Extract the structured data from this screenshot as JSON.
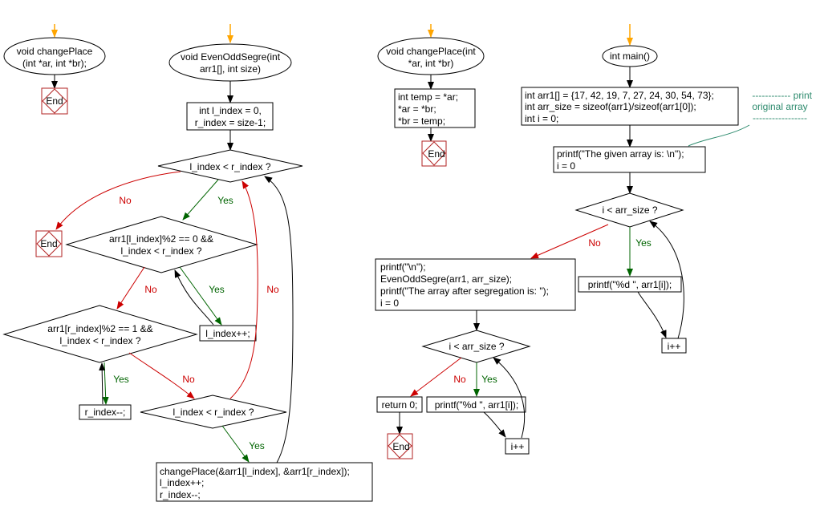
{
  "colors": {
    "yes": "#006400",
    "no": "#cc0000",
    "entry": "#ffa500",
    "end": "#b22222",
    "comment": "#2e8b6e"
  },
  "end_label": "End",
  "yes": "Yes",
  "no": "No",
  "changePlace_decl": {
    "lines": [
      "void changePlace",
      "(int *ar, int *br);"
    ]
  },
  "evenOdd": {
    "start": {
      "lines": [
        "void EvenOddSegre(int",
        "arr1[], int size)"
      ]
    },
    "init": {
      "lines": [
        "int l_index = 0,",
        "r_index = size-1;"
      ]
    },
    "cond_outer": "l_index < r_index ?",
    "cond_even": {
      "lines": [
        "arr1[l_index]%2 == 0 &&",
        "l_index < r_index ?"
      ]
    },
    "inc_l": "l_index++;",
    "cond_odd": {
      "lines": [
        "arr1[r_index]%2 == 1 &&",
        "l_index < r_index ?"
      ]
    },
    "dec_r": "r_index--;",
    "cond_swap": "l_index < r_index ?",
    "swap": {
      "lines": [
        "changePlace(&arr1[l_index], &arr1[r_index]);",
        "l_index++;",
        "r_index--;"
      ]
    }
  },
  "changePlace_def": {
    "start": {
      "lines": [
        "void changePlace(int",
        "*ar, int *br)"
      ]
    },
    "body": {
      "lines": [
        "int temp = *ar;",
        "*ar = *br;",
        "*br = temp;"
      ]
    }
  },
  "main": {
    "start": "int main()",
    "init": {
      "lines": [
        "int arr1[] = {17, 42, 19, 7, 27, 24, 30, 54, 73};",
        "int arr_size = sizeof(arr1)/sizeof(arr1[0]);",
        "int i = 0;"
      ]
    },
    "comment": {
      "lines": [
        "------------ print",
        "original array",
        "-----------------"
      ]
    },
    "print_header": {
      "lines": [
        "printf(\"The given array is:  \\n\");",
        "i = 0"
      ]
    },
    "loop1_cond": "i < arr_size ?",
    "loop1_print": "printf(\"%d  \", arr1[i]);",
    "loop1_inc": "i++",
    "after": {
      "lines": [
        "printf(\"\\n\");",
        "EvenOddSegre(arr1, arr_size);",
        "printf(\"The array after segregation is:  \");",
        "i = 0"
      ]
    },
    "loop2_cond": "i < arr_size ?",
    "return": "return 0;",
    "loop2_print": "printf(\"%d \", arr1[i]);",
    "loop2_inc": "i++"
  }
}
